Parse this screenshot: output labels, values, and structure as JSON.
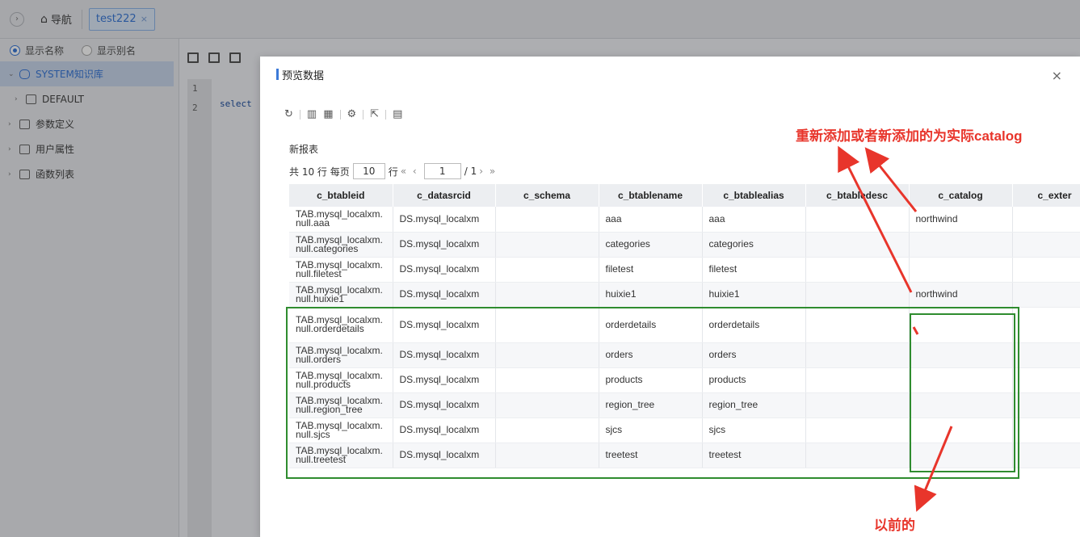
{
  "topbar": {
    "nav_label": "导航",
    "tab_label": "test222",
    "tab_close": "×",
    "collapse_icon": "chevron-right-icon"
  },
  "sidebar": {
    "display_name": "显示名称",
    "display_alias": "显示别名",
    "root": "SYSTEM知识库",
    "items": [
      {
        "label": "DEFAULT"
      },
      {
        "label": "参数定义"
      },
      {
        "label": "用户属性"
      },
      {
        "label": "函数列表"
      }
    ]
  },
  "editor": {
    "line1": "1",
    "line2": "2",
    "code_text": "select"
  },
  "modal": {
    "title": "预览数据",
    "close": "×",
    "report_name": "新报表",
    "pager": {
      "total": "共 10 行",
      "per_page_label": "每页",
      "per_page": "10",
      "row_unit": "行",
      "first_prev": "«  ‹",
      "page": "1",
      "of_pages": "/ 1",
      "next_last": "›  »"
    },
    "columns": [
      "c_btableid",
      "c_datasrcid",
      "c_schema",
      "c_btablename",
      "c_btablealias",
      "c_btabledesc",
      "c_catalog",
      "c_exter"
    ],
    "rows": [
      {
        "id": "TAB.mysql_localxm.null.aaa",
        "ds": "DS.mysql_localxm",
        "schema": "",
        "name": "aaa",
        "alias": "aaa",
        "desc": "",
        "catalog": "northwind"
      },
      {
        "id": "TAB.mysql_localxm.null.categories",
        "ds": "DS.mysql_localxm",
        "schema": "",
        "name": "categories",
        "alias": "categories",
        "desc": "",
        "catalog": ""
      },
      {
        "id": "TAB.mysql_localxm.null.filetest",
        "ds": "DS.mysql_localxm",
        "schema": "",
        "name": "filetest",
        "alias": "filetest",
        "desc": "",
        "catalog": ""
      },
      {
        "id": "TAB.mysql_localxm.null.huixie1",
        "ds": "DS.mysql_localxm",
        "schema": "",
        "name": "huixie1",
        "alias": "huixie1",
        "desc": "",
        "catalog": "northwind"
      },
      {
        "id": "TAB.mysql_localxm.null.orderdetails",
        "ds": "DS.mysql_localxm",
        "schema": "",
        "name": "orderdetails",
        "alias": "orderdetails",
        "desc": "",
        "catalog": ""
      },
      {
        "id": "TAB.mysql_localxm.null.orders",
        "ds": "DS.mysql_localxm",
        "schema": "",
        "name": "orders",
        "alias": "orders",
        "desc": "",
        "catalog": ""
      },
      {
        "id": "TAB.mysql_localxm.null.products",
        "ds": "DS.mysql_localxm",
        "schema": "",
        "name": "products",
        "alias": "products",
        "desc": "",
        "catalog": ""
      },
      {
        "id": "TAB.mysql_localxm.null.region_tree",
        "ds": "DS.mysql_localxm",
        "schema": "",
        "name": "region_tree",
        "alias": "region_tree",
        "desc": "",
        "catalog": ""
      },
      {
        "id": "TAB.mysql_localxm.null.sjcs",
        "ds": "DS.mysql_localxm",
        "schema": "",
        "name": "sjcs",
        "alias": "sjcs",
        "desc": "",
        "catalog": ""
      },
      {
        "id": "TAB.mysql_localxm.null.treetest",
        "ds": "DS.mysql_localxm",
        "schema": "",
        "name": "treetest",
        "alias": "treetest",
        "desc": "",
        "catalog": ""
      }
    ]
  },
  "annotations": {
    "top_note": "重新添加或者新添加的为实际catalog",
    "bottom_note": "以前的",
    "color": "#e8352b",
    "box_color": "#2f8c2f"
  }
}
